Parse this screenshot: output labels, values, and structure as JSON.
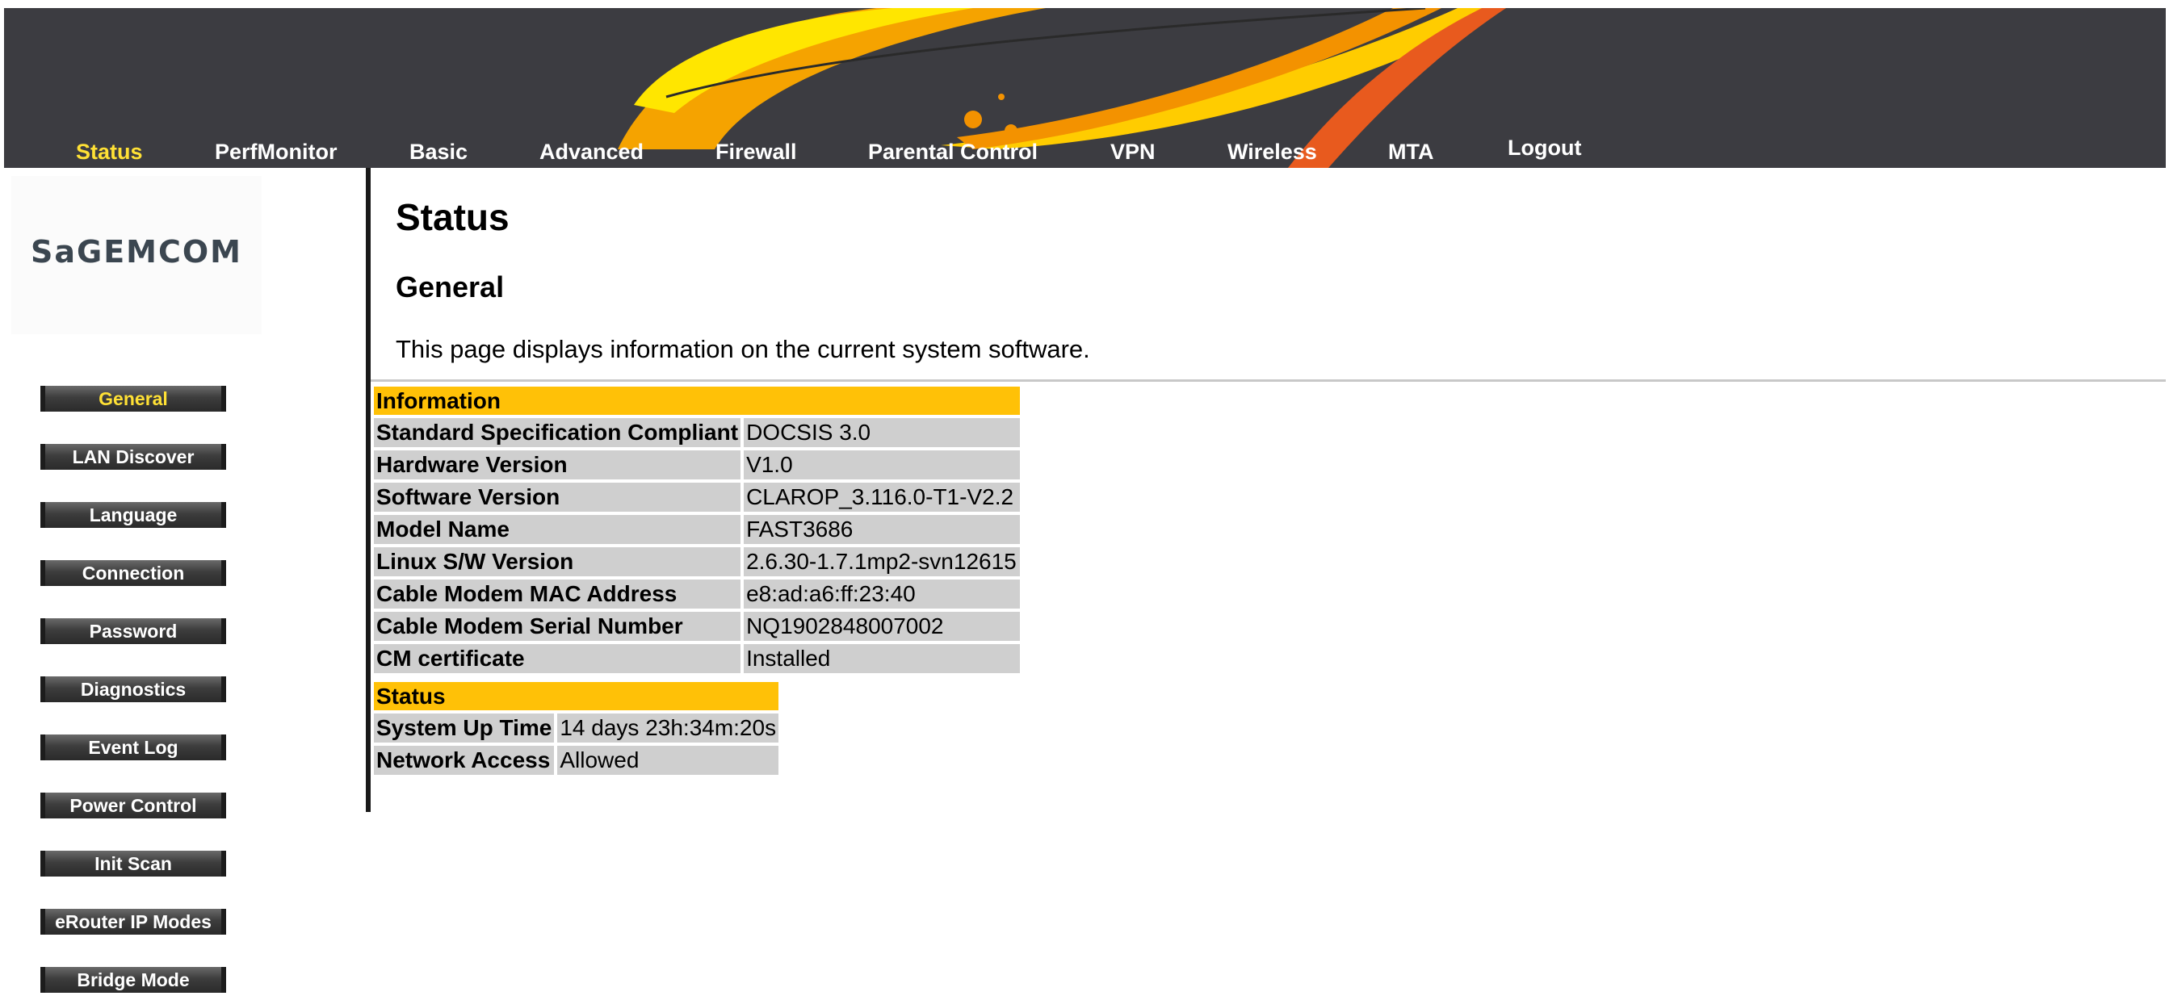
{
  "top_nav": [
    {
      "label": "Status",
      "active": true
    },
    {
      "label": "PerfMonitor"
    },
    {
      "label": "Basic"
    },
    {
      "label": "Advanced"
    },
    {
      "label": "Firewall"
    },
    {
      "label": "Parental Control"
    },
    {
      "label": "VPN"
    },
    {
      "label": "Wireless"
    },
    {
      "label": "MTA"
    },
    {
      "label": "Logout"
    }
  ],
  "logo": {
    "text": "SaGEMCOM"
  },
  "side_menu": [
    {
      "label": "General",
      "active": true
    },
    {
      "label": "LAN Discover"
    },
    {
      "label": "Language"
    },
    {
      "label": "Connection"
    },
    {
      "label": "Password"
    },
    {
      "label": "Diagnostics"
    },
    {
      "label": "Event Log"
    },
    {
      "label": "Power Control"
    },
    {
      "label": "Init Scan"
    },
    {
      "label": "eRouter IP Modes"
    },
    {
      "label": "Bridge Mode"
    }
  ],
  "content": {
    "title": "Status",
    "subtitle": "General",
    "description": "This page displays information on the current system software."
  },
  "info_table": {
    "header": "Information",
    "rows": [
      {
        "label": "Standard Specification Compliant",
        "value": "DOCSIS 3.0"
      },
      {
        "label": "Hardware Version",
        "value": "V1.0"
      },
      {
        "label": "Software Version",
        "value": "CLAROP_3.116.0-T1-V2.2"
      },
      {
        "label": "Model Name",
        "value": "FAST3686"
      },
      {
        "label": "Linux S/W Version",
        "value": "2.6.30-1.7.1mp2-svn12615"
      },
      {
        "label": "Cable Modem MAC Address",
        "value": "e8:ad:a6:ff:23:40"
      },
      {
        "label": "Cable Modem Serial Number",
        "value": "NQ1902848007002"
      },
      {
        "label": "CM certificate",
        "value": "Installed"
      }
    ]
  },
  "status_table": {
    "header": "Status",
    "rows": [
      {
        "label": "System Up Time",
        "value": "14 days 23h:34m:20s"
      },
      {
        "label": "Network Access",
        "value": "Allowed"
      }
    ]
  },
  "colors": {
    "header_bg": "#3c3c41",
    "active_text": "#ffe135",
    "table_header": "#ffc107",
    "table_cell": "#cfcfcf"
  }
}
